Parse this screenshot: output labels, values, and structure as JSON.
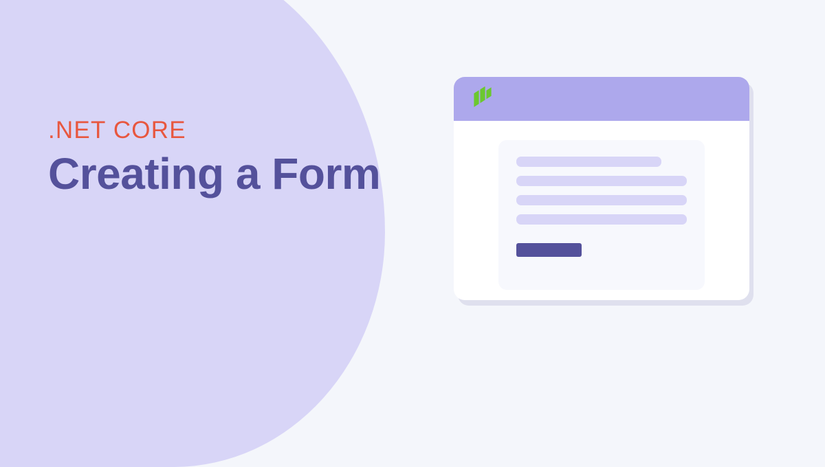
{
  "hero": {
    "eyebrow": ".NET CORE",
    "heading": "Creating a Form"
  },
  "colors": {
    "background": "#F4F6FB",
    "blob": "#D8D5F7",
    "accent": "#E8573F",
    "primary": "#54519B",
    "logo": "#6BC82E",
    "titlebar": "#ADA8EC"
  },
  "illustration": {
    "logo_name": "progress-icon",
    "form_lines": 4,
    "has_button": true
  }
}
